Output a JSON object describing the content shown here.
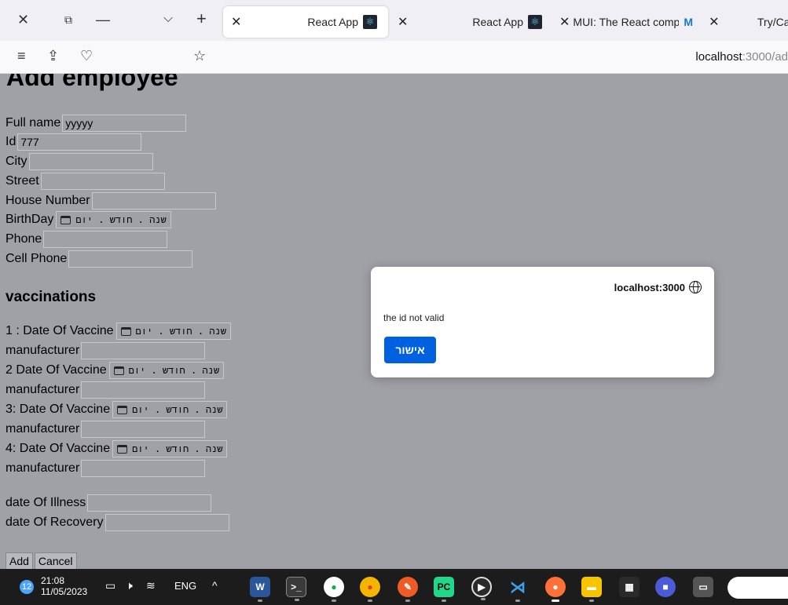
{
  "browser": {
    "tabs": [
      {
        "title": "React App",
        "active": true
      },
      {
        "title": "React App",
        "active": false
      },
      {
        "title": "MUI: The React compone",
        "active": false
      },
      {
        "title": "Try/Ca",
        "active": false
      }
    ],
    "url_host": "localhost",
    "url_rest": ":3000/ad"
  },
  "form": {
    "title": "Add employee",
    "full_name_label": "Full name",
    "full_name_value": "yyyyy",
    "id_label": "Id",
    "id_value": "777",
    "city_label": "City",
    "street_label": "Street",
    "house_label": "House Number",
    "birthday_label": "BirthDay",
    "date_placeholder": "שנה . חודש . יום",
    "phone_label": "Phone",
    "cell_label": "Cell Phone",
    "vaccinations_heading": "vaccinations",
    "vaccines": [
      {
        "date_label": "1 : Date Of Vaccine",
        "manufacturer_label": "manufacturer"
      },
      {
        "date_label": "2 Date Of Vaccine",
        "manufacturer_label": "manufacturer"
      },
      {
        "date_label": "3: Date Of Vaccine",
        "manufacturer_label": "manufacturer"
      },
      {
        "date_label": "4: Date Of Vaccine",
        "manufacturer_label": "manufacturer"
      }
    ],
    "illness_label": "date Of Illness",
    "recovery_label": "date Of Recovery",
    "add_label": "Add",
    "cancel_label": "Cancel"
  },
  "dialog": {
    "origin": "localhost:3000",
    "message": "the id not valid",
    "ok_label": "אישור"
  },
  "taskbar": {
    "notification_count": "12",
    "time": "21:08",
    "date": "11/05/2023",
    "language": "ENG"
  }
}
